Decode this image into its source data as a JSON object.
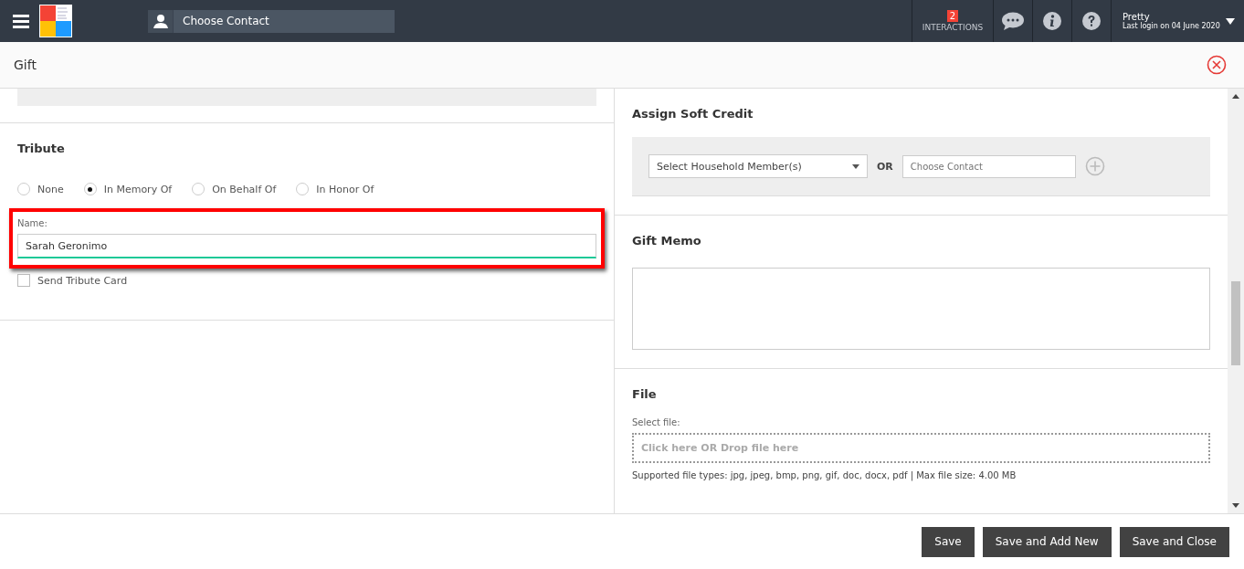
{
  "top_bar": {
    "contact_search": {
      "placeholder": "Choose Contact"
    },
    "interactions": {
      "count": "2",
      "label": "INTERACTIONS"
    },
    "user": {
      "name": "Pretty",
      "last_login": "Last login on 04 June 2020"
    }
  },
  "dialog": {
    "title": "Gift",
    "tribute": {
      "heading": "Tribute",
      "options": [
        {
          "label": "None",
          "selected": false
        },
        {
          "label": "In Memory Of",
          "selected": true
        },
        {
          "label": "On Behalf Of",
          "selected": false
        },
        {
          "label": "In Honor Of",
          "selected": false
        }
      ],
      "name_label": "Name:",
      "name_value": "Sarah Geronimo",
      "highlighted": true,
      "send_card": {
        "label": "Send Tribute Card",
        "checked": false
      }
    },
    "soft_credit": {
      "heading": "Assign Soft Credit",
      "household_select": "Select Household Member(s)",
      "or": "OR",
      "contact_placeholder": "Choose Contact"
    },
    "gift_memo": {
      "heading": "Gift Memo"
    },
    "file": {
      "heading": "File",
      "label": "Select file:",
      "dropzone": "Click here OR Drop file here",
      "note": "Supported file types: jpg, jpeg, bmp, png, gif, doc, docx, pdf | Max file size: 4.00 MB"
    },
    "buttons": [
      "Save",
      "Save and Add New",
      "Save and Close"
    ]
  }
}
